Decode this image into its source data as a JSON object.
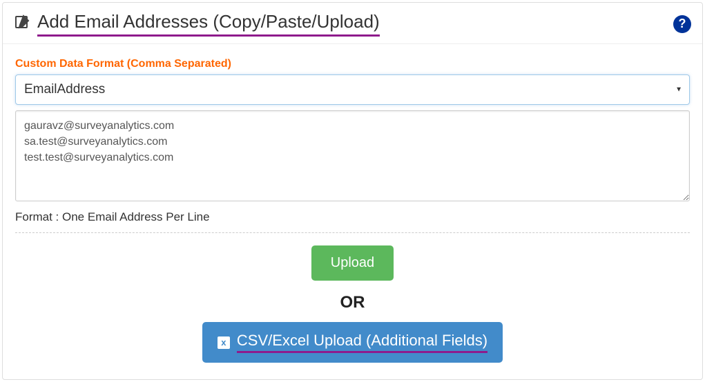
{
  "header": {
    "title": "Add Email Addresses (Copy/Paste/Upload)"
  },
  "form": {
    "data_format_label": "Custom Data Format (Comma Separated)",
    "selected_format": "EmailAddress",
    "email_text": "gauravz@surveyanalytics.com\nsa.test@surveyanalytics.com\ntest.test@surveyanalytics.com",
    "format_hint": "Format : One Email Address Per Line"
  },
  "actions": {
    "upload_label": "Upload",
    "or_label": "OR",
    "csv_label": "CSV/Excel Upload (Additional Fields)"
  }
}
